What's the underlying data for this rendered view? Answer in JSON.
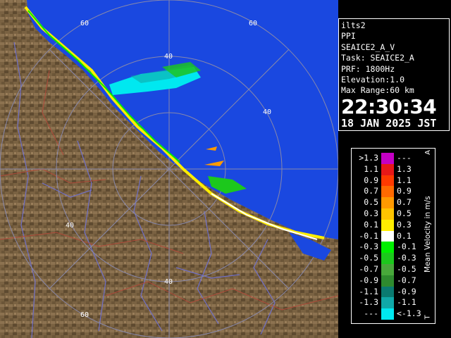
{
  "info": {
    "lines": [
      "ilts2",
      "PPI",
      "SEAICE2_A_V",
      "Task: SEAICE2_A",
      "PRF: 1800Hz",
      "Elevation:1.0",
      "Max Range:60 km"
    ],
    "time": "22:30:34",
    "date": "18 JAN 2025 JST"
  },
  "range_labels": [
    "60",
    "60",
    "40",
    "40",
    "40",
    "40",
    "60"
  ],
  "legend": {
    "title": "Mean Velocity in m/s",
    "top_mark": "A",
    "bottom_mark": "T",
    "rows": [
      {
        "lo": ">1.3",
        "hi": "---",
        "color": "#c400c4"
      },
      {
        "lo": "1.1",
        "hi": "1.3",
        "color": "#e81818"
      },
      {
        "lo": "0.9",
        "hi": "1.1",
        "color": "#ff3a00"
      },
      {
        "lo": "0.7",
        "hi": "0.9",
        "color": "#ff6a00"
      },
      {
        "lo": "0.5",
        "hi": "0.7",
        "color": "#ff9a00"
      },
      {
        "lo": "0.3",
        "hi": "0.5",
        "color": "#ffc400"
      },
      {
        "lo": "0.1",
        "hi": "0.3",
        "color": "#ffee00"
      },
      {
        "lo": "-0.1",
        "hi": "0.1",
        "color": "#ffffff"
      },
      {
        "lo": "-0.3",
        "hi": "-0.1",
        "color": "#00ee00"
      },
      {
        "lo": "-0.5",
        "hi": "-0.3",
        "color": "#1cc81c"
      },
      {
        "lo": "-0.7",
        "hi": "-0.5",
        "color": "#48a83a"
      },
      {
        "lo": "-0.9",
        "hi": "-0.7",
        "color": "#2e8a2e"
      },
      {
        "lo": "-1.1",
        "hi": "-0.9",
        "color": "#0a7a70"
      },
      {
        "lo": "-1.3",
        "hi": "-1.1",
        "color": "#10a8a8"
      },
      {
        "lo": "---",
        "hi": "<-1.3",
        "color": "#00e8f0"
      }
    ]
  },
  "colors": {
    "sea": "#1a48e0",
    "land": "#7a6242",
    "land_dark": "#5e4a30",
    "river": "#7070c8",
    "boundary": "#b04a3a",
    "ring": "#8888aa"
  }
}
